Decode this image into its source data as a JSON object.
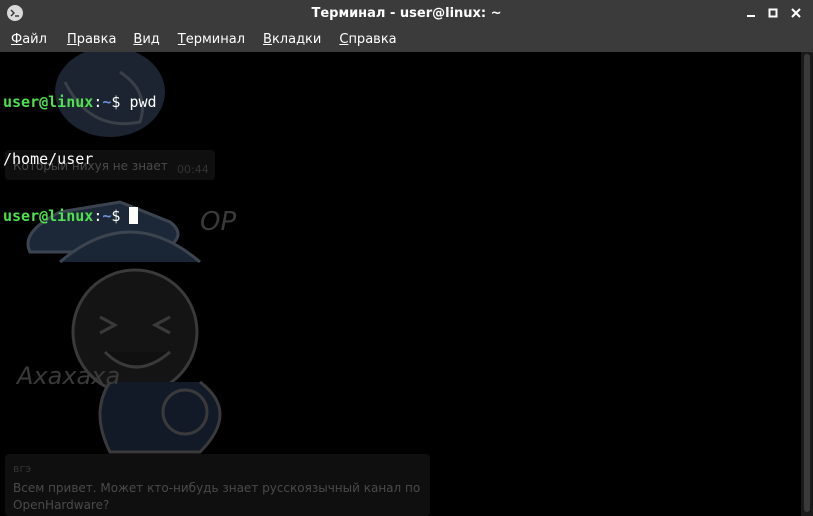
{
  "window": {
    "title": "Терминал - user@linux: ~"
  },
  "menu": {
    "items": [
      {
        "acc": "Ф",
        "rest": "айл"
      },
      {
        "acc": "П",
        "rest": "равка"
      },
      {
        "acc": "В",
        "rest": "ид"
      },
      {
        "acc": "Т",
        "rest": "ерминал"
      },
      {
        "acc": "В",
        "rest": "кладки"
      },
      {
        "acc": "С",
        "rest": "правка"
      }
    ]
  },
  "terminal": {
    "lines": [
      {
        "user": "user@linux",
        "sep": ":",
        "path": "~",
        "symbol": "$ ",
        "command": "pwd"
      },
      {
        "output": "/home/user"
      },
      {
        "user": "user@linux",
        "sep": ":",
        "path": "~",
        "symbol": "$ ",
        "command": ""
      }
    ],
    "background": {
      "message_1": "Который нихуя не знает",
      "time_1": "00:44",
      "op_text": "OP",
      "laugh_text": "Ахахаха",
      "sender": "вгэ",
      "message_2_line_1": "Всем привет. Может кто-нибудь знает русскоязычный канал по",
      "message_2_line_2": "OpenHardware?"
    }
  },
  "colors": {
    "titlebar_bg": "#3b3b3b",
    "terminal_bg": "#000000",
    "prompt_user": "#4fe04f",
    "prompt_path": "#6d8fe0"
  }
}
